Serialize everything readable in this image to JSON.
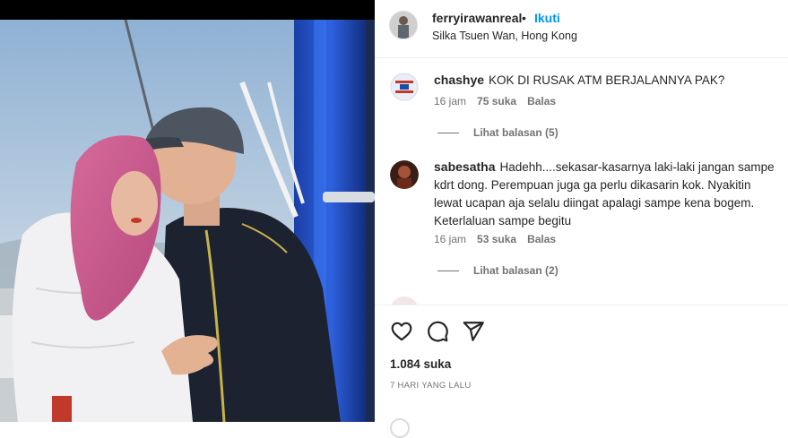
{
  "post": {
    "username": "ferryirawanreal",
    "separator": "•",
    "follow_label": "Ikuti",
    "location": "Silka Tsuen Wan, Hong Kong"
  },
  "comments": [
    {
      "username": "chashye",
      "text": "KOK DI RUSAK ATM BERJALANNYA PAK?",
      "time": "16 jam",
      "likes": "75 suka",
      "reply_label": "Balas",
      "view_replies": "Lihat balasan (5)"
    },
    {
      "username": "sabesatha",
      "text": "Hadehh....sekasar-kasarnya laki-laki jangan sampe kdrt dong. Perempuan juga ga perlu dikasarin kok. Nyakitin lewat ucapan aja selalu diingat apalagi sampe kena bogem. Keterlaluan sampe begitu",
      "time": "16 jam",
      "likes": "53 suka",
      "reply_label": "Balas",
      "view_replies": "Lihat balasan (2)"
    }
  ],
  "actions": {
    "like_icon": "heart-icon",
    "comment_icon": "comment-icon",
    "share_icon": "share-icon",
    "likes_count": "1.084 suka",
    "time_ago": "7 HARI YANG LALU"
  },
  "colors": {
    "accent": "#0095f6",
    "text": "#262626",
    "secondary": "#737373",
    "divider": "#efefef"
  }
}
